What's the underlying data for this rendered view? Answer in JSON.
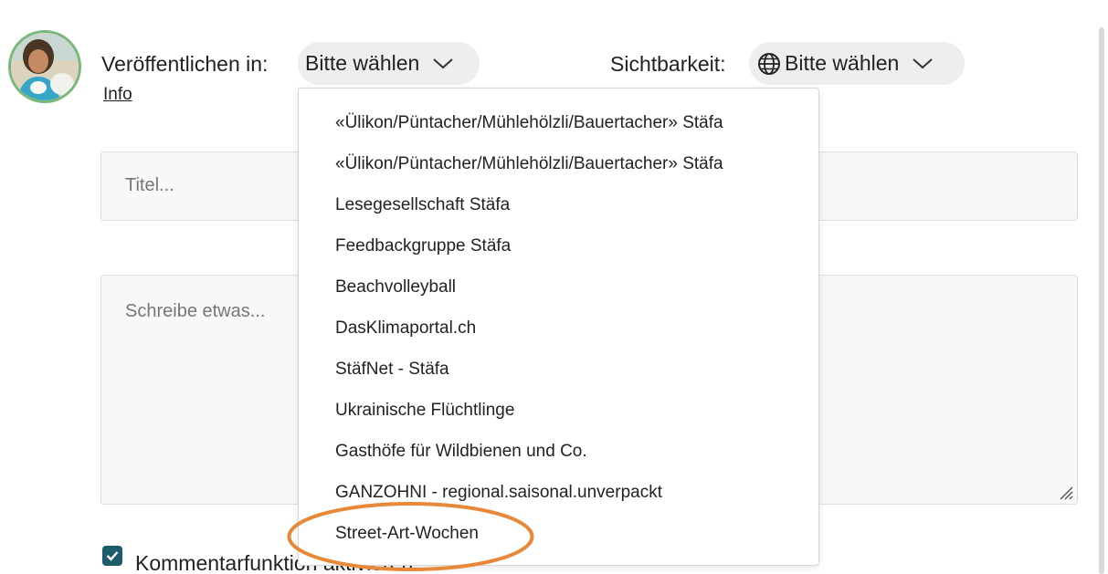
{
  "composer": {
    "publish_label": "Veröffentlichen in:",
    "publish_select": "Bitte wählen",
    "visibility_label": "Sichtbarkeit:",
    "visibility_select": "Bitte wählen",
    "info_link": "Info",
    "title_placeholder": "Titel...",
    "body_placeholder": "Schreibe etwas...",
    "comment_toggle_label": "Kommentarfunktion aktivieren",
    "comment_toggle_checked": true
  },
  "dropdown": {
    "options": [
      "«Ülikon/Püntacher/Mühlehölzli/Bauertacher» Stäfa",
      "«Ülikon/Püntacher/Mühlehölzli/Bauertacher» Stäfa",
      "Lesegesellschaft Stäfa",
      "Feedbackgruppe Stäfa",
      "Beachvolleyball",
      "DasKlimaportal.ch",
      "StäfNet - Stäfa",
      "Ukrainische Flüchtlinge",
      "Gasthöfe für Wildbienen und Co.",
      "GANZOHNI - regional.saisonal.unverpackt",
      "Street-Art-Wochen"
    ],
    "highlighted_option": "Street-Art-Wochen"
  },
  "colors": {
    "highlight_ring": "#e8893a",
    "checkbox": "#1d5c6b",
    "avatar_border": "#7ab87a"
  },
  "icons": [
    "globe-icon",
    "chevron-down-icon",
    "check-icon",
    "resize-handle-icon"
  ]
}
